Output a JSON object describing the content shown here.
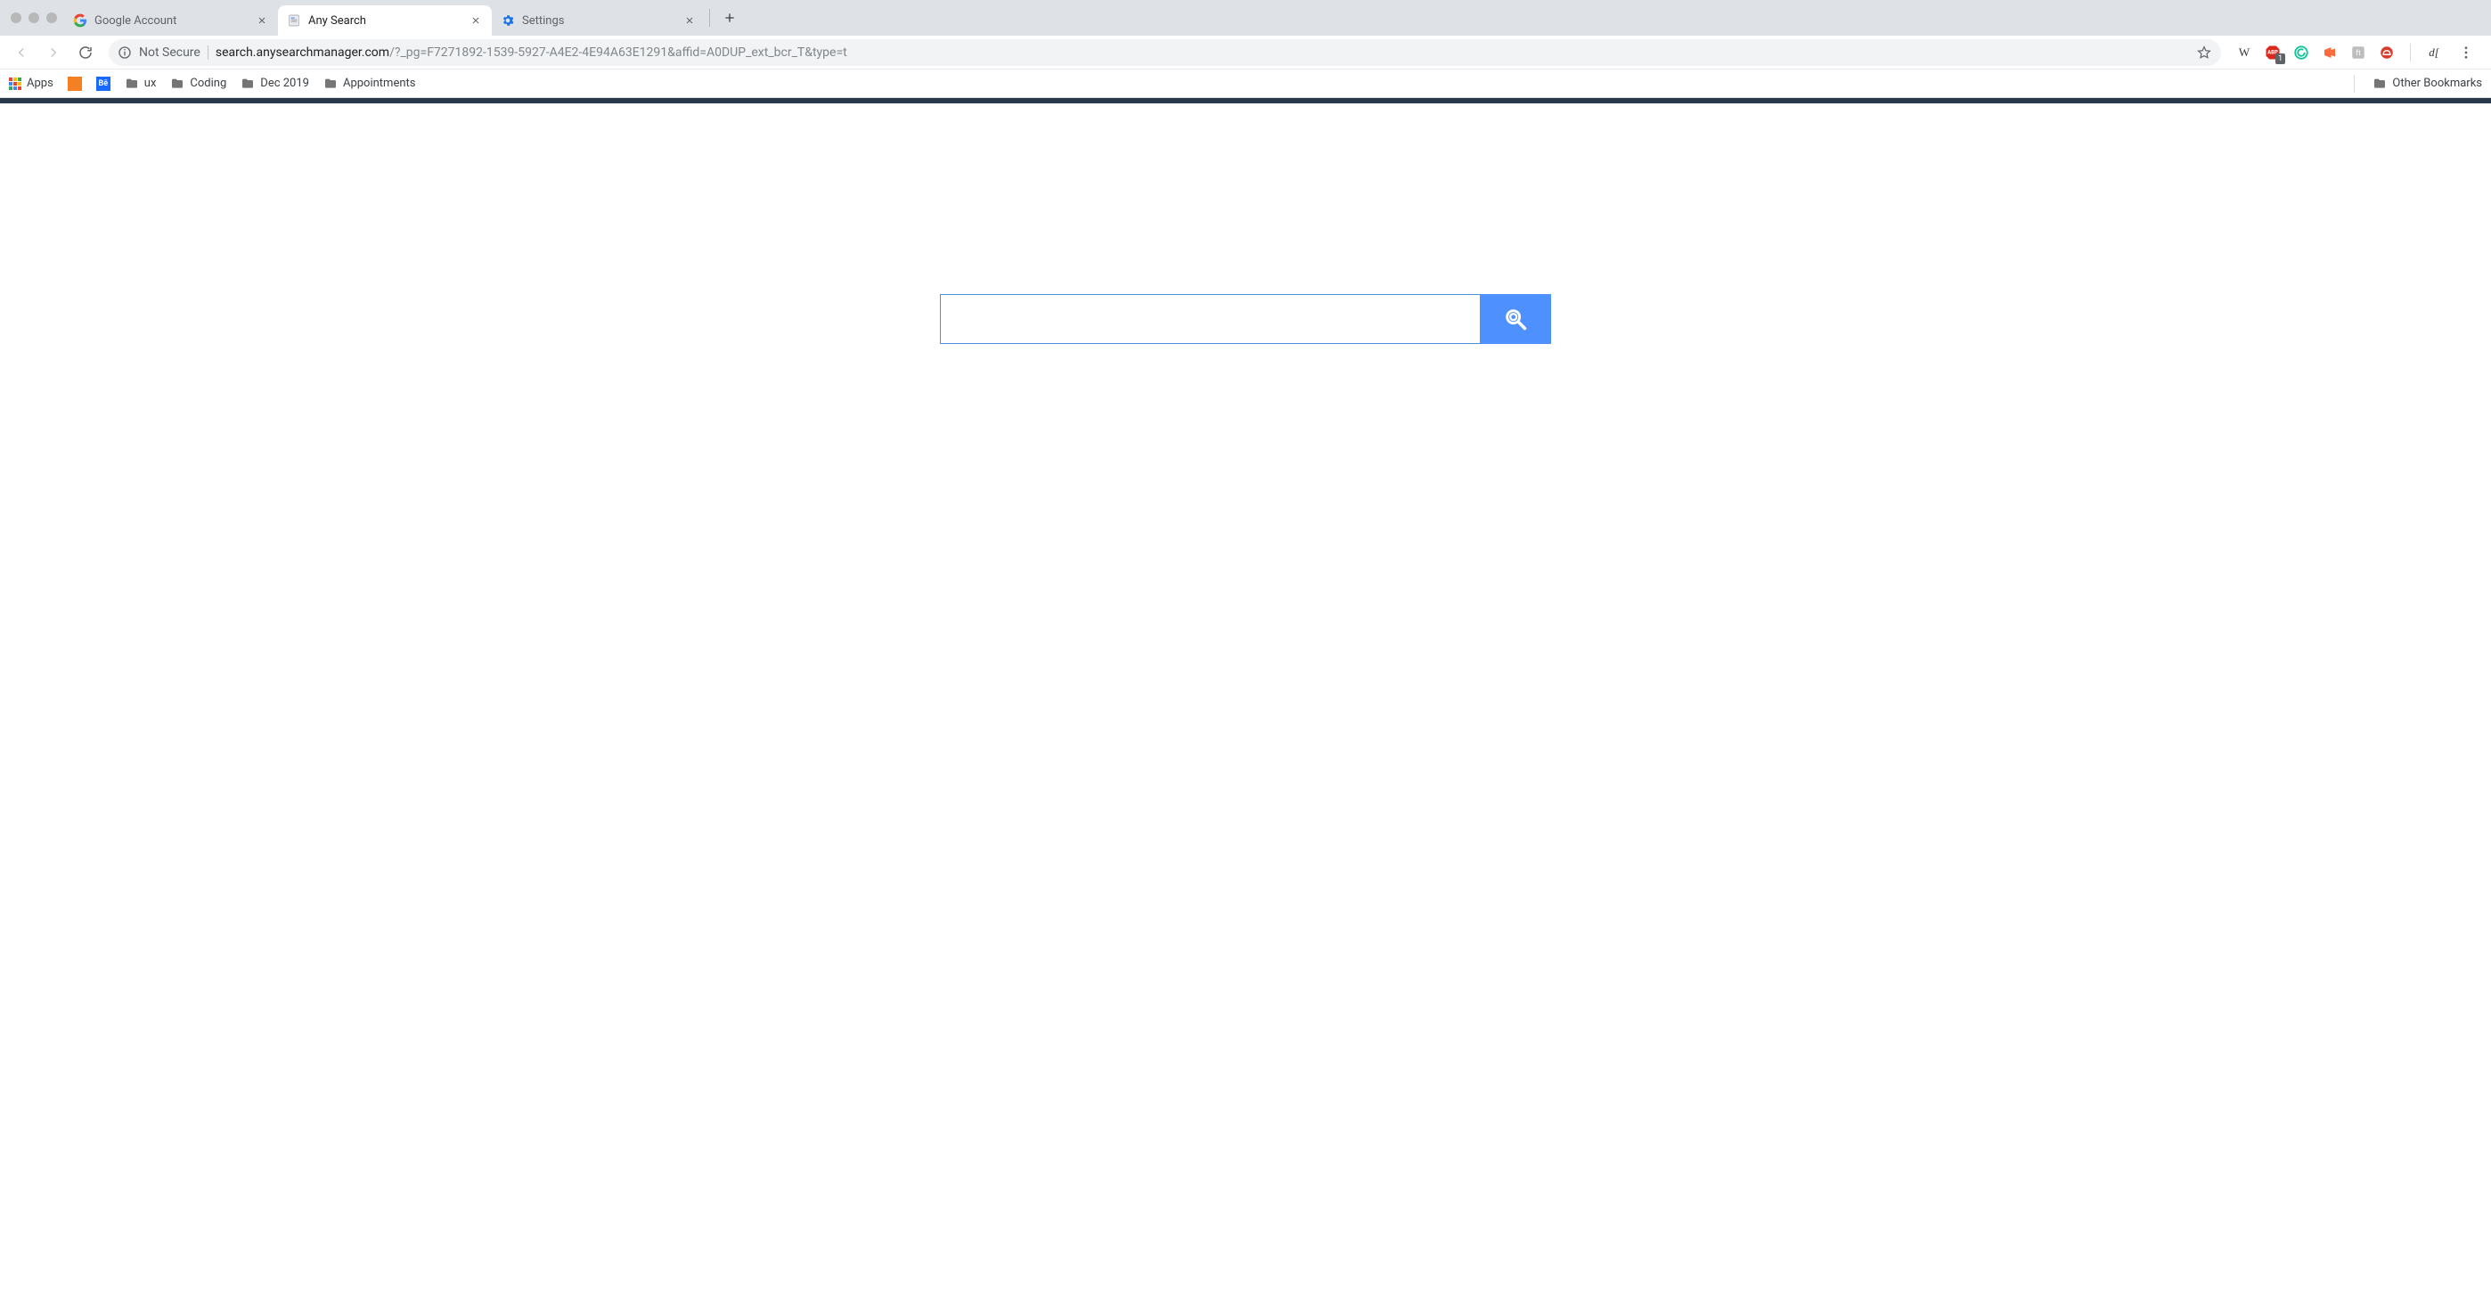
{
  "tabs": [
    {
      "title": "Google Account",
      "favicon": "google"
    },
    {
      "title": "Any Search",
      "favicon": "page"
    },
    {
      "title": "Settings",
      "favicon": "gear"
    }
  ],
  "omnibox": {
    "security_label": "Not Secure",
    "host": "search.anysearchmanager.com",
    "path": "/?_pg=F7271892-1539-5927-A4E2-4E94A63E1291&affid=A0DUP_ext_bcr_T&type=t"
  },
  "extensions": {
    "abp_badge": "1",
    "df_label": "d["
  },
  "bookmarks": {
    "apps": "Apps",
    "items": [
      {
        "label": "ux",
        "icon": "folder"
      },
      {
        "label": "Coding",
        "icon": "folder"
      },
      {
        "label": "Dec 2019",
        "icon": "folder"
      },
      {
        "label": "Appointments",
        "icon": "folder"
      }
    ],
    "other": "Other Bookmarks"
  },
  "search": {
    "placeholder": ""
  }
}
